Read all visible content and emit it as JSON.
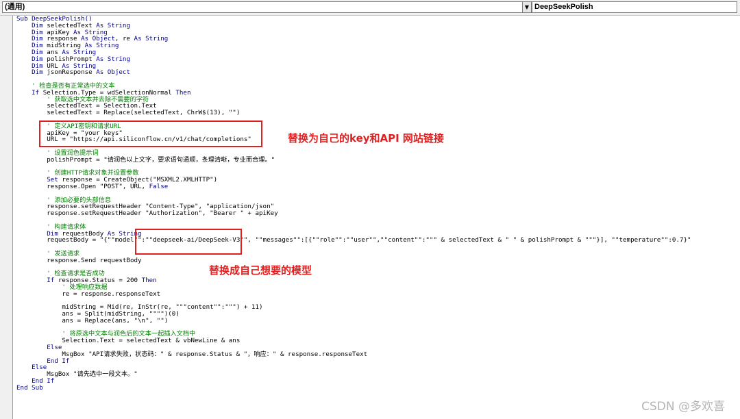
{
  "toolbar": {
    "object_combo": "(通用)",
    "procedure_combo": "DeepSeekPolish"
  },
  "code_lines": [
    [
      {
        "t": "Sub DeepSeekPolish()",
        "c": "kw"
      }
    ],
    [
      {
        "t": "    "
      },
      {
        "t": "Dim",
        "c": "kw"
      },
      {
        "t": " selectedText "
      },
      {
        "t": "As String",
        "c": "kw"
      }
    ],
    [
      {
        "t": "    "
      },
      {
        "t": "Dim",
        "c": "kw"
      },
      {
        "t": " apiKey "
      },
      {
        "t": "As String",
        "c": "kw"
      }
    ],
    [
      {
        "t": "    "
      },
      {
        "t": "Dim",
        "c": "kw"
      },
      {
        "t": " response "
      },
      {
        "t": "As Object",
        "c": "kw"
      },
      {
        "t": ", re "
      },
      {
        "t": "As String",
        "c": "kw"
      }
    ],
    [
      {
        "t": "    "
      },
      {
        "t": "Dim",
        "c": "kw"
      },
      {
        "t": " midString "
      },
      {
        "t": "As String",
        "c": "kw"
      }
    ],
    [
      {
        "t": "    "
      },
      {
        "t": "Dim",
        "c": "kw"
      },
      {
        "t": " ans "
      },
      {
        "t": "As String",
        "c": "kw"
      }
    ],
    [
      {
        "t": "    "
      },
      {
        "t": "Dim",
        "c": "kw"
      },
      {
        "t": " polishPrompt "
      },
      {
        "t": "As String",
        "c": "kw"
      }
    ],
    [
      {
        "t": "    "
      },
      {
        "t": "Dim",
        "c": "kw"
      },
      {
        "t": " URL "
      },
      {
        "t": "As String",
        "c": "kw"
      }
    ],
    [
      {
        "t": "    "
      },
      {
        "t": "Dim",
        "c": "kw"
      },
      {
        "t": " jsonResponse "
      },
      {
        "t": "As Object",
        "c": "kw"
      }
    ],
    [
      {
        "t": ""
      }
    ],
    [
      {
        "t": "    ' 检查是否有正常选中的文本",
        "c": "cm"
      }
    ],
    [
      {
        "t": "    "
      },
      {
        "t": "If",
        "c": "kw"
      },
      {
        "t": " Selection.Type = wdSelectionNormal "
      },
      {
        "t": "Then",
        "c": "kw"
      }
    ],
    [
      {
        "t": "        ' 获取选中文本并去除不需要的字符",
        "c": "cm"
      }
    ],
    [
      {
        "t": "        selectedText = Selection.Text"
      }
    ],
    [
      {
        "t": "        selectedText = Replace(selectedText, ChrW$(13), \"\")"
      }
    ],
    [
      {
        "t": ""
      }
    ],
    [
      {
        "t": "        ' 定义API密钥和请求URL",
        "c": "cm"
      }
    ],
    [
      {
        "t": "        apiKey = \"your keys\""
      }
    ],
    [
      {
        "t": "        URL = \"https://api.siliconflow.cn/v1/chat/completions\""
      }
    ],
    [
      {
        "t": ""
      }
    ],
    [
      {
        "t": "        ' 设置润色提示词",
        "c": "cm"
      }
    ],
    [
      {
        "t": "        polishPrompt = \"请润色以上文字，要求语句通顺，条理清晰，专业而合理。\""
      }
    ],
    [
      {
        "t": ""
      }
    ],
    [
      {
        "t": "        ' 创建HTTP请求对象并设置参数",
        "c": "cm"
      }
    ],
    [
      {
        "t": "        "
      },
      {
        "t": "Set",
        "c": "kw"
      },
      {
        "t": " response = CreateObject(\"MSXML2.XMLHTTP\")"
      }
    ],
    [
      {
        "t": "        response.Open \"POST\", URL, "
      },
      {
        "t": "False",
        "c": "kw"
      }
    ],
    [
      {
        "t": ""
      }
    ],
    [
      {
        "t": "        ' 添加必要的头部信息",
        "c": "cm"
      }
    ],
    [
      {
        "t": "        response.setRequestHeader \"Content-Type\", \"application/json\""
      }
    ],
    [
      {
        "t": "        response.setRequestHeader \"Authorization\", \"Bearer \" + apiKey"
      }
    ],
    [
      {
        "t": ""
      }
    ],
    [
      {
        "t": "        ' 构建请求体",
        "c": "cm"
      }
    ],
    [
      {
        "t": "        "
      },
      {
        "t": "Dim",
        "c": "kw"
      },
      {
        "t": " requestBody "
      },
      {
        "t": "As String",
        "c": "kw"
      }
    ],
    [
      {
        "t": "        requestBody = \"{\"\"model\"\":\"\"deepseek-ai/DeepSeek-V3\"\", \"\"messages\"\":[{\"\"role\"\":\"\"user\"\",\"\"content\"\":\"\"\" & selectedText & \" \" & polishPrompt & \"\"\"}], \"\"temperature\"\":0.7}\""
      }
    ],
    [
      {
        "t": ""
      }
    ],
    [
      {
        "t": "        ' 发送请求",
        "c": "cm"
      }
    ],
    [
      {
        "t": "        response.Send requestBody"
      }
    ],
    [
      {
        "t": ""
      }
    ],
    [
      {
        "t": "        ' 检查请求是否成功",
        "c": "cm"
      }
    ],
    [
      {
        "t": "        "
      },
      {
        "t": "If",
        "c": "kw"
      },
      {
        "t": " response.Status = 200 "
      },
      {
        "t": "Then",
        "c": "kw"
      }
    ],
    [
      {
        "t": "            ' 处理响应数据",
        "c": "cm"
      }
    ],
    [
      {
        "t": "            re = response.responseText"
      }
    ],
    [
      {
        "t": ""
      }
    ],
    [
      {
        "t": "            midString = Mid(re, InStr(re, \"\"\"content\"\":\"\"\") + 11)"
      }
    ],
    [
      {
        "t": "            ans = Split(midString, \"\"\"\")(0)"
      }
    ],
    [
      {
        "t": "            ans = Replace(ans, \"\\n\", \"\")"
      }
    ],
    [
      {
        "t": ""
      }
    ],
    [
      {
        "t": "            ' 将原选中文本与润色后的文本一起插入文档中",
        "c": "cm"
      }
    ],
    [
      {
        "t": "            Selection.Text = selectedText & vbNewLine & ans"
      }
    ],
    [
      {
        "t": "        "
      },
      {
        "t": "Else",
        "c": "kw"
      }
    ],
    [
      {
        "t": "            MsgBox \"API请求失败，状态码：\" & response.Status & \"，响应：\" & response.responseText"
      }
    ],
    [
      {
        "t": "        "
      },
      {
        "t": "End If",
        "c": "kw"
      }
    ],
    [
      {
        "t": "    "
      },
      {
        "t": "Else",
        "c": "kw"
      }
    ],
    [
      {
        "t": "        MsgBox \"请先选中一段文本。\""
      }
    ],
    [
      {
        "t": "    "
      },
      {
        "t": "End If",
        "c": "kw"
      }
    ],
    [
      {
        "t": "End Sub",
        "c": "kw"
      }
    ]
  ],
  "annotations": {
    "note_key": "替换为自己的key和API 网站链接",
    "note_model": "替换成自己想要的模型"
  },
  "watermark": "CSDN @多欢喜",
  "colors": {
    "keyword": "#00008b",
    "comment": "#007f00",
    "annotation": "#e02020"
  }
}
